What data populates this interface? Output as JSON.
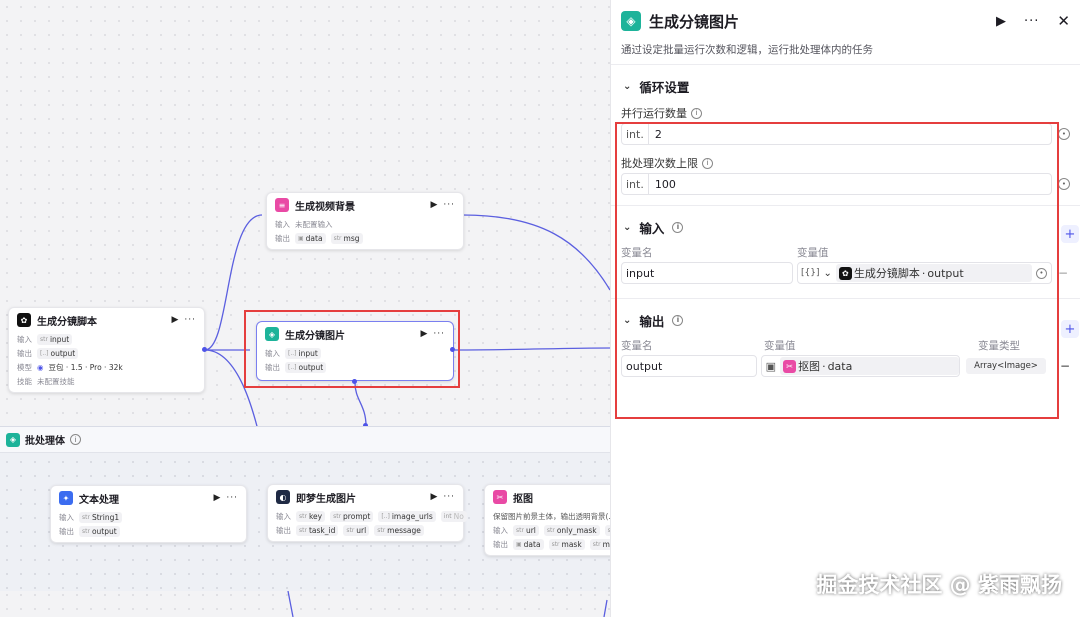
{
  "canvas": {
    "node_video_bg": {
      "title": "生成视频背景",
      "in_label": "输入",
      "in_value": "未配置输入",
      "out_label": "输出",
      "outputs": [
        "data",
        "msg"
      ]
    },
    "node_script": {
      "title": "生成分镜脚本",
      "in_label": "输入",
      "input": "input",
      "out_label": "输出",
      "output": "output",
      "model_label": "模型",
      "model": "豆包 · 1.5 · Pro · 32k",
      "skill_label": "技能",
      "skill_value": "未配置技能"
    },
    "node_image": {
      "title": "生成分镜图片",
      "in_label": "输入",
      "input": "input",
      "out_label": "输出",
      "output": "output"
    },
    "batch": {
      "title": "批处理体"
    },
    "node_text": {
      "title": "文本处理",
      "in_label": "输入",
      "input": "String1",
      "out_label": "输出",
      "output": "output"
    },
    "node_jimeng": {
      "title": "即梦生成图片",
      "in_label": "输入",
      "inputs": [
        "key",
        "prompt",
        "image_urls",
        "No"
      ],
      "out_label": "输出",
      "outputs": [
        "task_id",
        "url",
        "message"
      ]
    },
    "node_cutout": {
      "title": "抠图",
      "desc": "保留图片前景主体，输出透明背景(.png)",
      "in_label": "输入",
      "inputs": [
        "url",
        "only_mask",
        "outp"
      ],
      "out_label": "输出",
      "outputs": [
        "data",
        "mask",
        "msg"
      ]
    }
  },
  "panel": {
    "title": "生成分镜图片",
    "description": "通过设定批量运行次数和逻辑，运行批处理体内的任务",
    "loop_section": "循环设置",
    "parallel_label": "并行运行数量",
    "parallel_type": "int.",
    "parallel_value": "2",
    "batch_limit_label": "批处理次数上限",
    "batch_limit_type": "int.",
    "batch_limit_value": "100",
    "input_section": "输入",
    "input_col_name": "变量名",
    "input_col_value": "变量值",
    "input_var_name": "input",
    "input_ref_type": "[{}]",
    "input_ref_node": "生成分镜脚本",
    "input_ref_var": "output",
    "output_section": "输出",
    "output_col_name": "变量名",
    "output_col_value": "变量值",
    "output_col_type": "变量类型",
    "output_var_name": "output",
    "output_ref_node": "抠图",
    "output_ref_var": "data",
    "output_type": "Array<Image>"
  },
  "watermark": "掘金技术社区 @ 紫雨飘扬",
  "colors": {
    "accent": "#4d53e8",
    "highlight": "#e53e3e",
    "teal": "#1db39a",
    "pink": "#e94aa5"
  }
}
